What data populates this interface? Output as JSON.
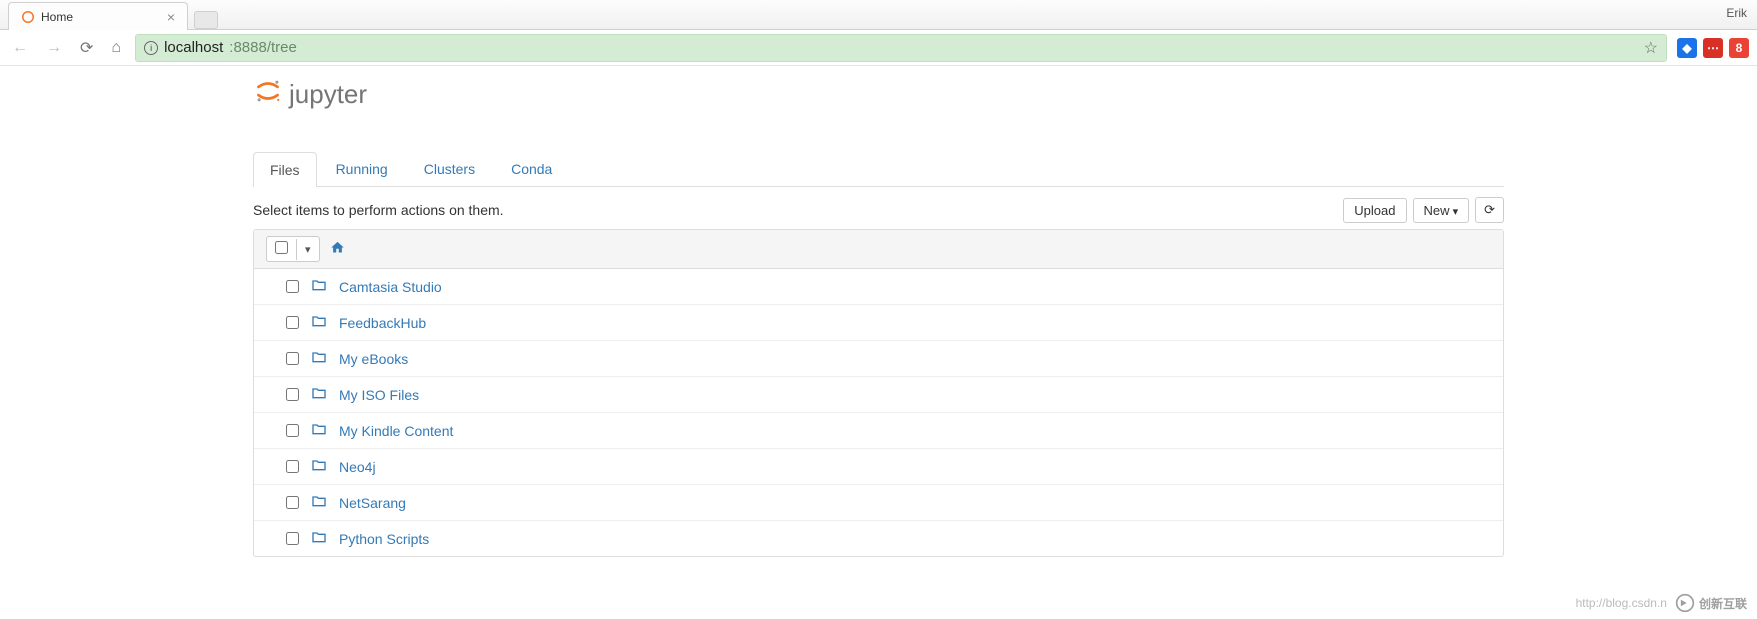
{
  "browser": {
    "tab_title": "Home",
    "profile": "Erik",
    "url_host": "localhost",
    "url_rest": ":8888/tree"
  },
  "logo_text": "jupyter",
  "tabs": [
    {
      "label": "Files",
      "active": true
    },
    {
      "label": "Running",
      "active": false
    },
    {
      "label": "Clusters",
      "active": false
    },
    {
      "label": "Conda",
      "active": false
    }
  ],
  "hint": "Select items to perform actions on them.",
  "buttons": {
    "upload": "Upload",
    "new": "New"
  },
  "items": [
    {
      "name": "Camtasia Studio"
    },
    {
      "name": "FeedbackHub"
    },
    {
      "name": "My eBooks"
    },
    {
      "name": "My ISO Files"
    },
    {
      "name": "My Kindle Content"
    },
    {
      "name": "Neo4j"
    },
    {
      "name": "NetSarang"
    },
    {
      "name": "Python Scripts"
    }
  ],
  "watermark": {
    "url": "http://blog.csdn.n",
    "brand": "创新互联"
  }
}
